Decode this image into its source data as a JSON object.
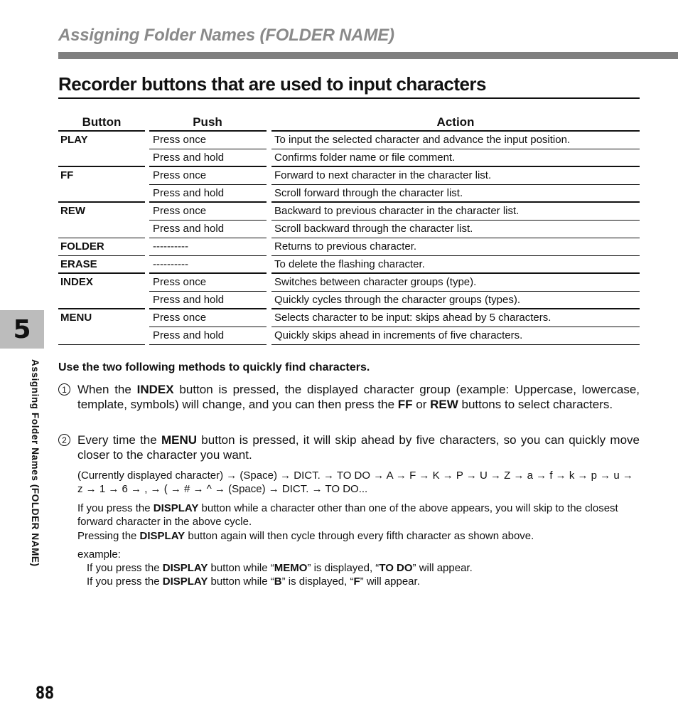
{
  "header": {
    "section_title": "Assigning Folder Names (FOLDER NAME)",
    "page_title": "Recorder buttons that are used to input characters"
  },
  "table": {
    "columns": [
      "Button",
      "Push",
      "Action"
    ],
    "groups": [
      {
        "button": "PLAY",
        "rows": [
          {
            "push": "Press once",
            "action": "To input the selected character and advance the input position."
          },
          {
            "push": "Press and hold",
            "action": "Confirms folder name or file comment."
          }
        ]
      },
      {
        "button": "FF",
        "rows": [
          {
            "push": "Press once",
            "action": "Forward to next character in the character list."
          },
          {
            "push": "Press and hold",
            "action": "Scroll forward through the character list."
          }
        ]
      },
      {
        "button": "REW",
        "rows": [
          {
            "push": "Press once",
            "action": "Backward to previous character in the character list."
          },
          {
            "push": "Press and hold",
            "action": "Scroll backward through the character list."
          }
        ]
      },
      {
        "button": "FOLDER",
        "rows": [
          {
            "push": "----------",
            "action": "Returns to previous character."
          }
        ]
      },
      {
        "button": "ERASE",
        "rows": [
          {
            "push": "----------",
            "action": "To delete the flashing character."
          }
        ]
      },
      {
        "button": "INDEX",
        "rows": [
          {
            "push": "Press once",
            "action": "Switches between character groups (type)."
          },
          {
            "push": "Press and hold",
            "action": "Quickly cycles through the character groups (types)."
          }
        ]
      },
      {
        "button": "MENU",
        "rows": [
          {
            "push": "Press once",
            "action": "Selects character to be input: skips ahead by 5 characters."
          },
          {
            "push": "Press and hold",
            "action": "Quickly skips ahead in increments of five characters."
          }
        ]
      }
    ]
  },
  "methods": {
    "title": "Use the two following methods to quickly find characters.",
    "item1": {
      "num": "1",
      "t1": "When the ",
      "b1": "INDEX",
      "t2": " button is pressed, the displayed character group (example: Uppercase, lowercase, template, symbols) will change, and you can then press the ",
      "b2": "FF",
      "t3": " or ",
      "b3": "REW",
      "t4": " buttons to select characters."
    },
    "item2": {
      "num": "2",
      "t1": "Every time the ",
      "b1": "MENU",
      "t2": " button is pressed, it will skip ahead by five characters, so you can quickly move closer to the character you want."
    },
    "sequence": "(Currently displayed character) → (Space) → DICT. → TO DO → A → F → K → P → U → Z → a → f → k → p → u → z → 1 → 6 → , → ( → # → ^ → (Space) → DICT. → TO DO...",
    "note1": {
      "t1": "If you press the ",
      "b1": "DISPLAY",
      "t2": " button while a character other than one of the above appears, you will skip to the closest forward character in the above cycle."
    },
    "note2": {
      "t1": "Pressing the ",
      "b1": "DISPLAY",
      "t2": " button again will then cycle through every fifth character as shown above."
    },
    "example_label": "example:",
    "example1": {
      "t1": "If you press the ",
      "b1": "DISPLAY",
      "t2": " button while “",
      "b2": "MEMO",
      "t3": "” is displayed, “",
      "b3": "TO DO",
      "t4": "” will appear."
    },
    "example2": {
      "t1": "If you press the ",
      "b1": "DISPLAY",
      "t2": " button while “",
      "b2": "B",
      "t3": "” is displayed, “",
      "b3": "F",
      "t4": "” will appear."
    }
  },
  "sidebar": {
    "chapter_number": "5",
    "chapter_label": "Assigning Folder Names (FOLDER NAME)"
  },
  "footer": {
    "page_number": "88"
  }
}
